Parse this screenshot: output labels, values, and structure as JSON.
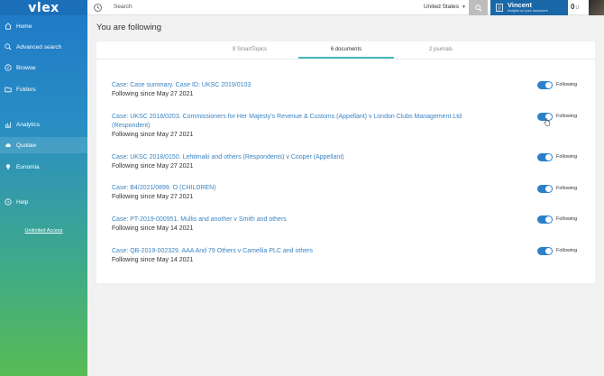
{
  "sidebar": {
    "logo": "vlex",
    "items": [
      {
        "label": "Home",
        "icon": "home-icon"
      },
      {
        "label": "Advanced search",
        "icon": "search-icon"
      },
      {
        "label": "Browse",
        "icon": "compass-icon"
      },
      {
        "label": "Folders",
        "icon": "folder-icon"
      },
      {
        "label": "Analytics",
        "icon": "analytics-icon"
      },
      {
        "label": "Quolaw",
        "icon": "cloud-icon"
      },
      {
        "label": "Eunomia",
        "icon": "bulb-icon"
      },
      {
        "label": "Help",
        "icon": "help-icon"
      }
    ],
    "unlimited_link": "Unlimited Access"
  },
  "topbar": {
    "search_placeholder": "Search",
    "country": "United States",
    "user_name": "Vincent",
    "user_sub": "Insights on your document",
    "credits": "0",
    "credits_unit": "U"
  },
  "page": {
    "title": "You are following",
    "tabs": [
      "8 SmartTopics",
      "6 documents",
      "2 journals"
    ],
    "active_tab": 1,
    "toggle_label": "Following",
    "items": [
      {
        "title": "Case: Case summary. Case ID: UKSC 2019/0103",
        "since": "Following since May 27 2021"
      },
      {
        "title": "Case: UKSC 2018/0203. Commissioners for Her Majesty's Revenue & Customs (Appellant) v London Clubs Management Ltd (Respondent)",
        "since": "Following since May 27 2021"
      },
      {
        "title": "Case: UKSC 2018/0150. Lehtimaki and others (Respondents) v Cooper (Appellant)",
        "since": "Following since May 27 2021"
      },
      {
        "title": "Case: B4/2021/0899. O (CHILDREN)",
        "since": "Following since May 27 2021"
      },
      {
        "title": "Case: PT-2019-000951. Mullis and another v Smith and others",
        "since": "Following since May 14 2021"
      },
      {
        "title": "Case: QB-2019-002329. AAA And 79 Others v Camellia PLC and others",
        "since": "Following since May 14 2021"
      }
    ]
  },
  "colors": {
    "accent": "#2c80c9",
    "link": "#3a84c3",
    "tab_underline": "#45b8c0",
    "user_box": "#1a67a8"
  }
}
